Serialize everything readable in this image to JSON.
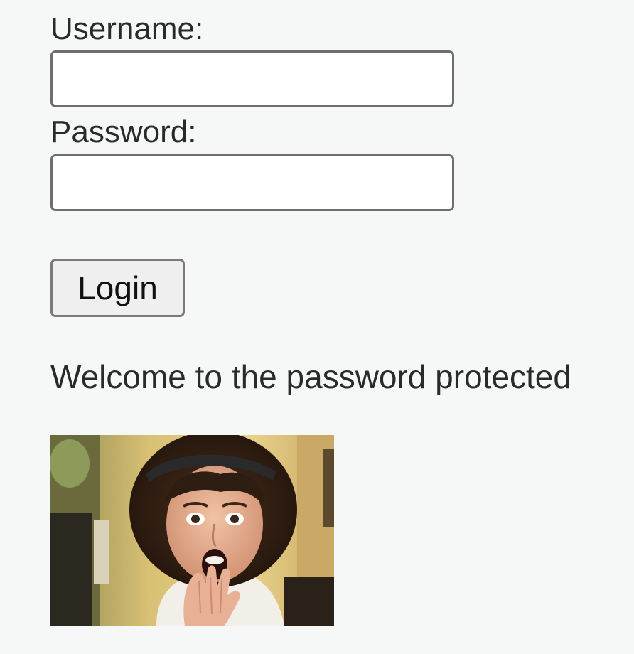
{
  "form": {
    "username_label": "Username:",
    "username_value": "",
    "password_label": "Password:",
    "password_value": "",
    "login_label": "Login"
  },
  "content": {
    "welcome_text": "Welcome to the password protected"
  },
  "image": {
    "subject": "surprised-person-photo"
  }
}
